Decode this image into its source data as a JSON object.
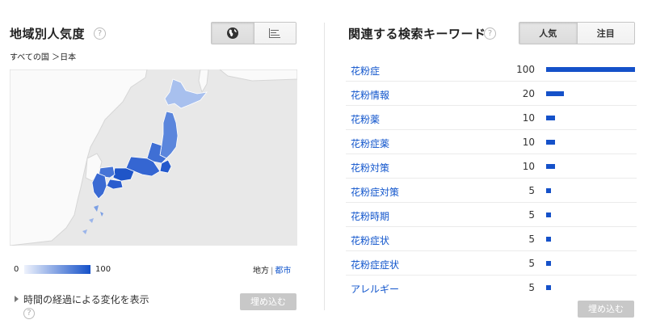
{
  "regional": {
    "title": "地域別人気度",
    "breadcrumb": "すべての国 ＞日本",
    "view_toggle": [
      {
        "icon": "globe-icon",
        "active": true
      },
      {
        "icon": "list-icon",
        "active": false
      }
    ],
    "legend": {
      "min": "0",
      "max": "100"
    },
    "level_links": {
      "region": "地方",
      "city": "都市"
    },
    "time_expander": "時間の経過による変化を表示",
    "embed_label": "埋め込む",
    "map_colors": {
      "low": "#eef2fc",
      "high": "#1551c9",
      "land": "#fafafa",
      "sea": "#e8e8e8"
    }
  },
  "related": {
    "title": "関連する検索キーワード",
    "sort_tabs": [
      {
        "label": "人気",
        "active": true
      },
      {
        "label": "注目",
        "active": false
      }
    ],
    "keywords": [
      {
        "term": "花粉症",
        "score": 100
      },
      {
        "term": "花粉情報",
        "score": 20
      },
      {
        "term": "花粉薬",
        "score": 10
      },
      {
        "term": "花粉症薬",
        "score": 10
      },
      {
        "term": "花粉対策",
        "score": 10
      },
      {
        "term": "花粉症対策",
        "score": 5
      },
      {
        "term": "花粉時期",
        "score": 5
      },
      {
        "term": "花粉症状",
        "score": 5
      },
      {
        "term": "花粉症症状",
        "score": 5
      },
      {
        "term": "アレルギー",
        "score": 5
      }
    ],
    "embed_label": "埋め込む",
    "bar_color": "#1551c9"
  }
}
